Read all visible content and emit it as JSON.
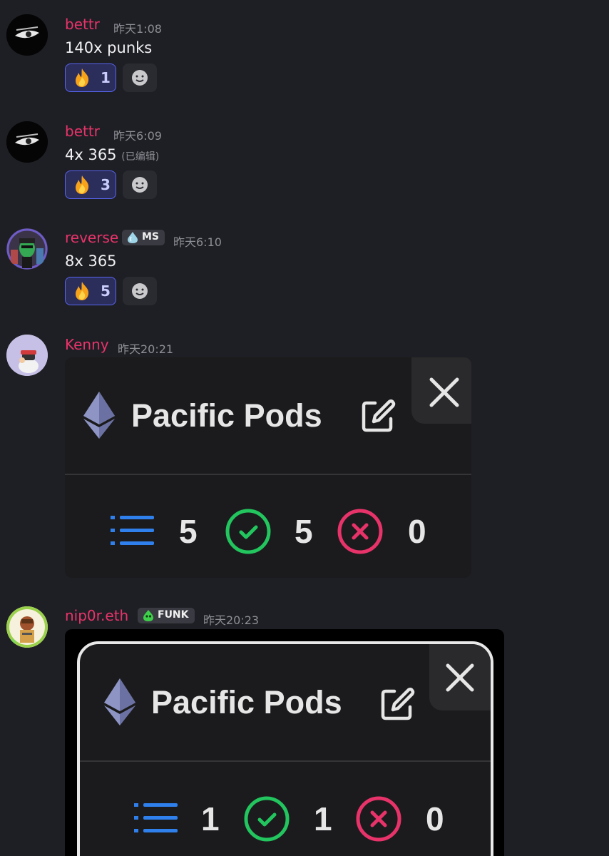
{
  "messages": [
    {
      "username": "bettr",
      "time": "昨天1:08",
      "text": "140x punks",
      "edited": "",
      "reaction": {
        "emoji": "fire-emoji",
        "count": "1"
      }
    },
    {
      "username": "bettr",
      "time": "昨天6:09",
      "text": "4x 365",
      "edited": "(已编辑)",
      "reaction": {
        "emoji": "fire-emoji",
        "count": "3"
      }
    },
    {
      "username": "reverse",
      "tag": "MS",
      "time": "昨天6:10",
      "text": "8x 365",
      "reaction": {
        "emoji": "fire-emoji",
        "count": "5"
      }
    },
    {
      "username": "Kenny",
      "time": "昨天20:21",
      "attachment": {
        "title": "Pacific Pods",
        "total": "5",
        "success": "5",
        "failed": "0"
      }
    },
    {
      "username": "nip0r.eth",
      "tag": "FUNK",
      "time": "昨天20:23",
      "attachment": {
        "title": "Pacific Pods",
        "total": "1",
        "success": "1",
        "failed": "0"
      }
    }
  ],
  "colors": {
    "background": "#1e1f24",
    "username": "#e8336a",
    "reaction_bg": "#2b2d5a",
    "reaction_border": "#5865f2",
    "success_green": "#22c55e",
    "fail_red": "#e8336a",
    "list_blue": "#2f80ed"
  }
}
